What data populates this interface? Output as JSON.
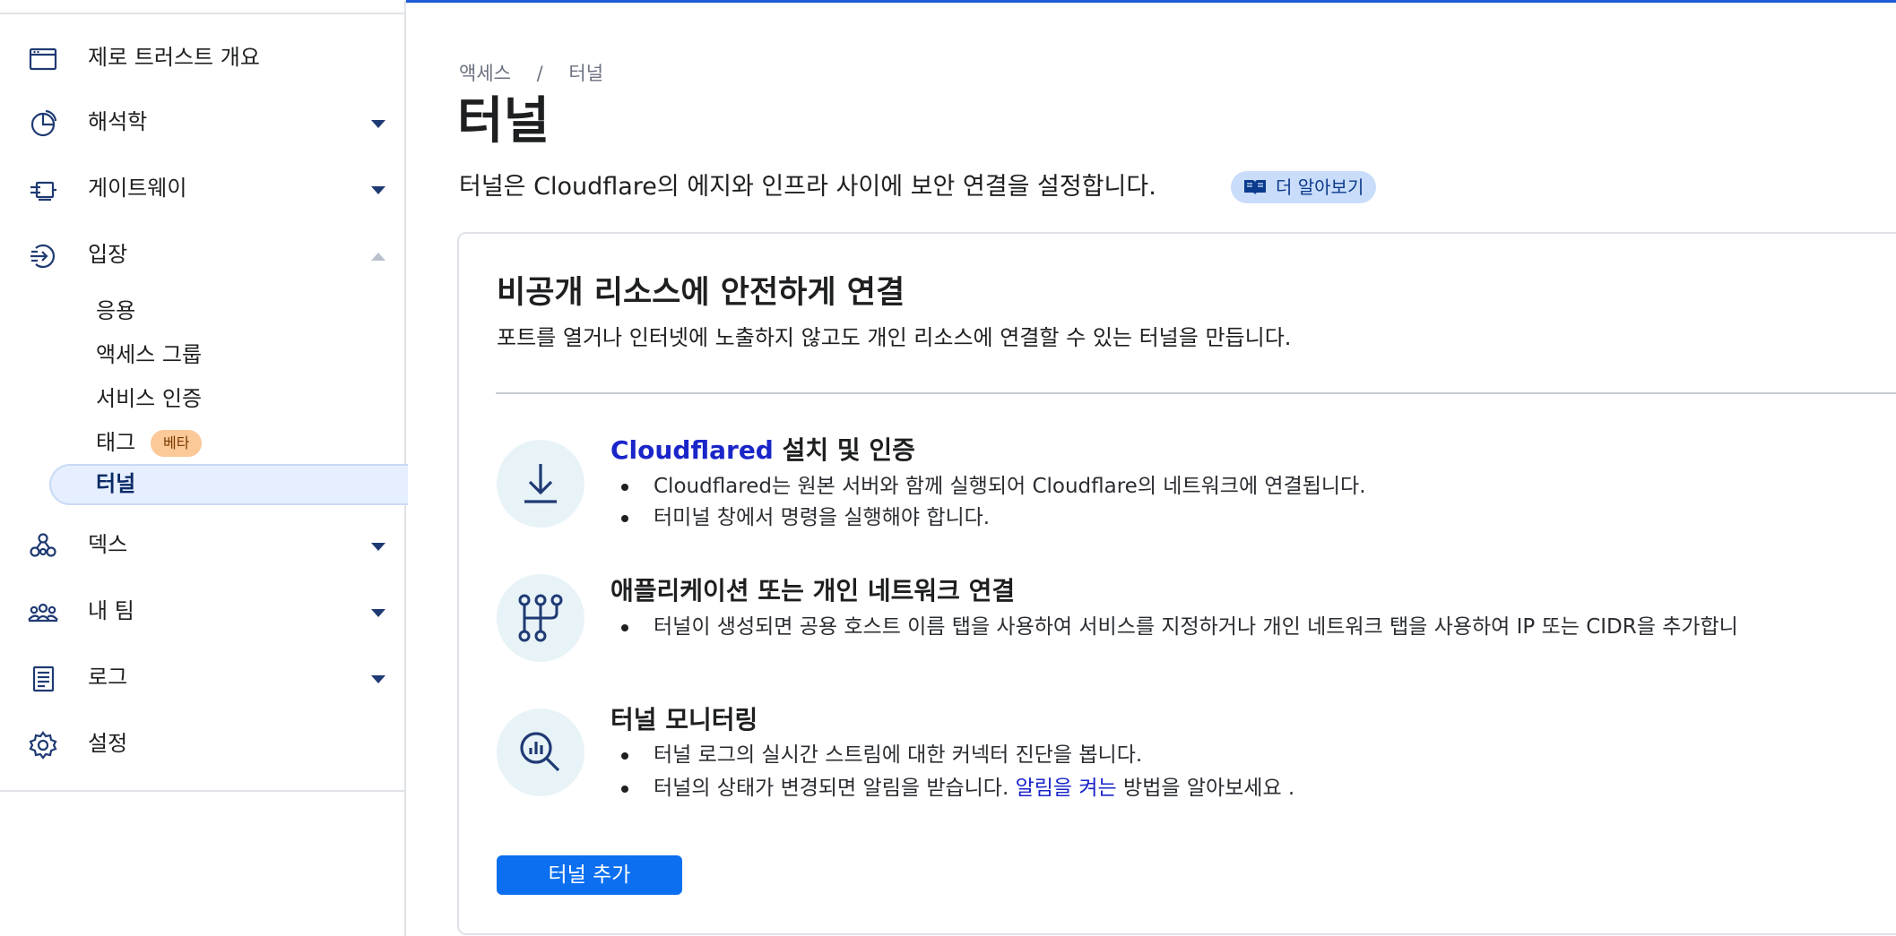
{
  "sidebar": {
    "items": [
      {
        "label": "제로 트러스트 개요",
        "icon": "browser-window-icon"
      },
      {
        "label": "해석학",
        "icon": "pie-chart-icon"
      },
      {
        "label": "게이트웨이",
        "icon": "gateway-icon"
      },
      {
        "label": "입장",
        "icon": "access-arrow-icon"
      },
      {
        "label": "덱스",
        "icon": "dex-nodes-icon"
      },
      {
        "label": "내 팀",
        "icon": "team-icon"
      },
      {
        "label": "로그",
        "icon": "log-icon"
      },
      {
        "label": "설정",
        "icon": "gear-icon"
      }
    ],
    "access_sub": [
      {
        "label": "응용"
      },
      {
        "label": "액세스 그룹"
      },
      {
        "label": "서비스 인증"
      },
      {
        "label": "태그",
        "badge": "베타"
      },
      {
        "label": "터널",
        "active": true
      }
    ]
  },
  "breadcrumb": {
    "parent": "액세스",
    "separator": "/",
    "current": "터널"
  },
  "page": {
    "title": "터널",
    "description": "터널은 Cloudflare의 에지와 인프라 사이에 보안 연결을 설정합니다.",
    "learn_more": "더 알아보기"
  },
  "card": {
    "title": "비공개 리소스에 안전하게 연결",
    "description": "포트를 열거나 인터넷에 노출하지 않고도 개인 리소스에 연결할 수 있는 터널을 만듭니다.",
    "steps": [
      {
        "title_accent": "Cloudflared",
        "title": " 설치 및 인증",
        "icon": "download-icon",
        "bullets": [
          "Cloudflared는 원본 서버와 함께 실행되어 Cloudflare의 네트워크에 연결됩니다.",
          "터미널 창에서 명령을 실행해야 합니다."
        ]
      },
      {
        "title": "애플리케이션 또는 개인 네트워크 연결",
        "icon": "network-branch-icon",
        "bullets": [
          "터널이 생성되면 공용 호스트 이름 탭을 사용하여 서비스를 지정하거나 개인 네트워크 탭을 사용하여 IP 또는 CIDR을 추가합니"
        ]
      },
      {
        "title": "터널 모니터링",
        "icon": "monitor-search-icon",
        "bullets": [
          "터널 로그의 실시간 스트림에 대한 커넥터 진단을 봅니다.",
          "터널의 상태가 변경되면 알림을 받습니다."
        ],
        "link_text": "알림을 켜는",
        "link_suffix": " 방법을 알아보세요 ."
      }
    ],
    "add_button": "터널 추가"
  },
  "colors": {
    "accent": "#0b6ff0",
    "link": "#1a25c9",
    "sidebar_icon": "#1f3a73",
    "active_bg": "#e6efff",
    "beta_badge": "#fbc898"
  }
}
